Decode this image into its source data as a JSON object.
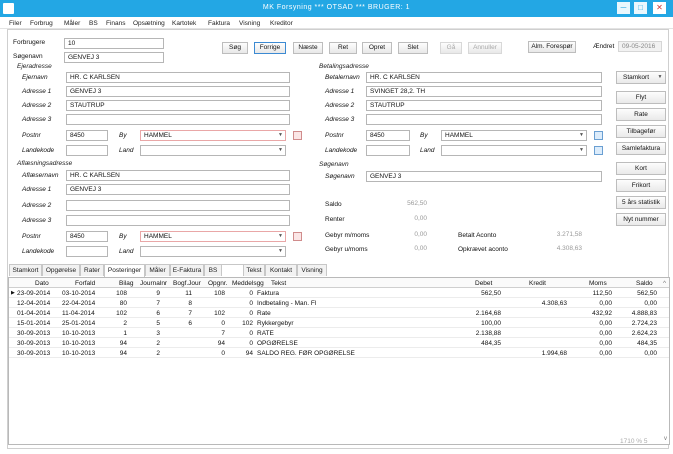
{
  "window": {
    "title": "MK Forsyning ***  OTSAD ***   BRUGER: 1",
    "min": "─",
    "max": "□",
    "close": "✕"
  },
  "menu": [
    "Filer",
    "Forbrug",
    "Måler",
    "BS",
    "Finans",
    "Opsætning",
    "Kartotek",
    "Faktura",
    "Visning",
    "Kreditor"
  ],
  "toolbar": {
    "forbrugere_label": "Forbrugere",
    "forbrugere_value": "10",
    "soegenavn_label": "Søgenavn",
    "soegenavn_value": "GENVEJ 3",
    "buttons": [
      "Søg",
      "Forrige",
      "Næste",
      "Ret",
      "Opret",
      "Slet",
      "Gå",
      "Annuller"
    ],
    "alm_button": "Alm. Forespør",
    "aendret_label": "Ændret",
    "aendret_value": "09-05-2016"
  },
  "ejer": {
    "section": "Ejeradresse",
    "ejernavn_label": "Ejernavn",
    "ejernavn": "HR. C KARLSEN",
    "adr1_label": "Adresse 1",
    "adr1": "GENVEJ 3",
    "adr2_label": "Adresse 2",
    "adr2": "STAUTRUP",
    "adr3_label": "Adresse 3",
    "adr3": "",
    "postnr_label": "Postnr",
    "postnr": "8450",
    "by_label": "By",
    "by": "HAMMEL",
    "landekode_label": "Landekode",
    "land_label": "Land"
  },
  "betaling": {
    "section": "Betalingsadresse",
    "navn_label": "Betalernavn",
    "navn": "HR. C KARLSEN",
    "adr1_label": "Adresse 1",
    "adr1": "SVINGET 28,2. TH",
    "adr2_label": "Adresse 2",
    "adr2": "STAUTRUP",
    "adr3_label": "Adresse 3",
    "adr3": "",
    "postnr_label": "Postnr",
    "postnr": "8450",
    "by_label": "By",
    "by": "HAMMEL",
    "landekode_label": "Landekode",
    "land_label": "Land"
  },
  "aflaes": {
    "section": "Aflæsningsadresse",
    "navn_label": "Aflæsernavn",
    "navn": "HR. C KARLSEN",
    "adr1_label": "Adresse 1",
    "adr1": "GENVEJ 3",
    "adr2_label": "Adresse 2",
    "adr2": "",
    "adr3_label": "Adresse 3",
    "adr3": "",
    "postnr_label": "Postnr",
    "postnr": "8450",
    "by_label": "By",
    "by": "HAMMEL",
    "landekode_label": "Landekode",
    "land_label": "Land"
  },
  "soeg": {
    "section": "Søgenavn",
    "label": "Søgenavn",
    "value": "GENVEJ 3"
  },
  "saldo": {
    "saldo_label": "Saldo",
    "saldo": "562,50",
    "renter_label": "Renter",
    "renter": "0,00",
    "gebyr_label": "Gebyr m/moms",
    "gebyr": "0,00",
    "gebyr2_label": "Gebyr u/moms",
    "gebyr2": "0,00",
    "betalt_label": "Betalt Aconto",
    "betalt": "3.271,58",
    "opkr_label": "Opkrævet aconto",
    "opkr": "4.308,63"
  },
  "right_buttons": [
    "Stamkort",
    "Flyt",
    "Rate",
    "Tilbagefør",
    "Samlefaktura",
    "Kort",
    "Frikort",
    "5 års statistik",
    "Nyt nummer"
  ],
  "tabs": [
    "Stamkort",
    "Opgørelse",
    "Rater",
    "Posteringer",
    "Måler",
    "E-Faktura",
    "BS",
    "Tekst",
    "Kontakt",
    "Visning"
  ],
  "grid": {
    "headers": [
      "Dato",
      "Forfald",
      "Bilag",
      "Journalnr",
      "Bogf.Jour",
      "Opgnr.",
      "Meddelsgg",
      "Tekst",
      "Debet",
      "Kredit",
      "Moms",
      "Saldo"
    ],
    "rows": [
      [
        "23-09-2014",
        "03-10-2014",
        "108",
        "9",
        "11",
        "108",
        "0",
        "Faktura",
        "562,50",
        "",
        "112,50",
        "562,50"
      ],
      [
        "12-04-2014",
        "22-04-2014",
        "80",
        "7",
        "8",
        "",
        "0",
        "Indbetaling - Man. Fl",
        "",
        "4.308,63",
        "0,00",
        "0,00"
      ],
      [
        "01-04-2014",
        "11-04-2014",
        "102",
        "6",
        "7",
        "102",
        "0",
        "Rate",
        "2.164,68",
        "",
        "432,92",
        "4.888,83"
      ],
      [
        "15-01-2014",
        "25-01-2014",
        "2",
        "5",
        "6",
        "0",
        "102",
        "Rykkergebyr",
        "100,00",
        "",
        "0,00",
        "2.724,23"
      ],
      [
        "30-09-2013",
        "10-10-2013",
        "1",
        "3",
        "",
        "7",
        "0",
        "RATE",
        "2.138,88",
        "",
        "0,00",
        "2.624,23"
      ],
      [
        "30-09-2013",
        "10-10-2013",
        "94",
        "2",
        "",
        "94",
        "0",
        "OPGØRELSE",
        "484,35",
        "",
        "0,00",
        "484,35"
      ],
      [
        "30-09-2013",
        "10-10-2013",
        "94",
        "2",
        "",
        "0",
        "94",
        "SALDO REG. FØR OPGØRELSE",
        "",
        "1.994,68",
        "0,00",
        "0,00"
      ]
    ]
  },
  "status": "1710 % 5"
}
